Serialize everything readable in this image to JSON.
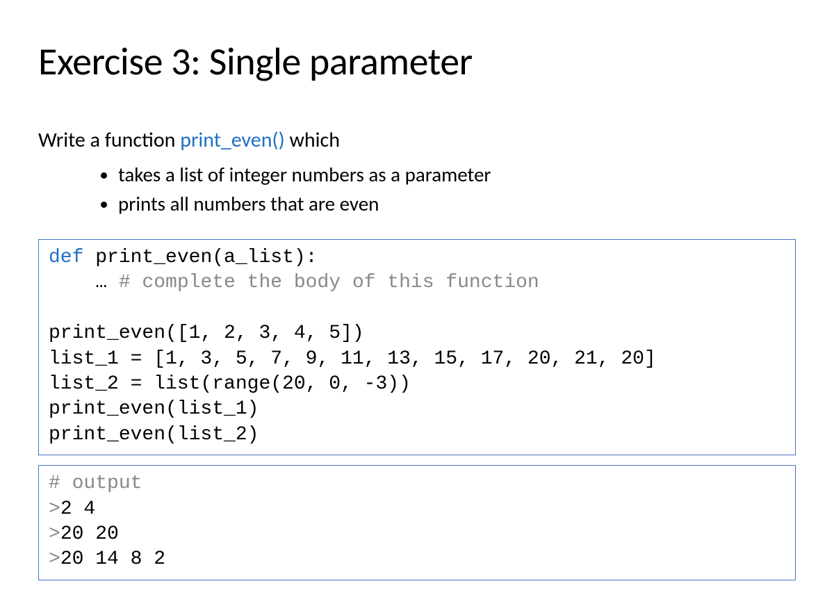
{
  "title": "Exercise 3: Single parameter",
  "intro": {
    "prefix": "Write a function ",
    "fn": "print_even()",
    "suffix": " which"
  },
  "bullets": [
    "takes a list of integer numbers as a parameter",
    "prints all numbers that are even"
  ],
  "codebox1": {
    "l1_kw": "def",
    "l1_rest": " print_even(a_list):",
    "l2_indent": "    … ",
    "l2_comment": "# complete the body of this function",
    "blank": "",
    "l4": "print_even([1, 2, 3, 4, 5])",
    "l5": "list_1 = [1, 3, 5, 7, 9, 11, 13, 15, 17, 20, 21, 20]",
    "l6": "list_2 = list(range(20, 0, -3))",
    "l7": "print_even(list_1)",
    "l8": "print_even(list_2)"
  },
  "codebox2": {
    "l1_comment": "# output",
    "l2_prompt": ">",
    "l2_text": "2 4",
    "l3_prompt": ">",
    "l3_text": "20 20",
    "l4_prompt": ">",
    "l4_text": "20 14 8 2"
  }
}
